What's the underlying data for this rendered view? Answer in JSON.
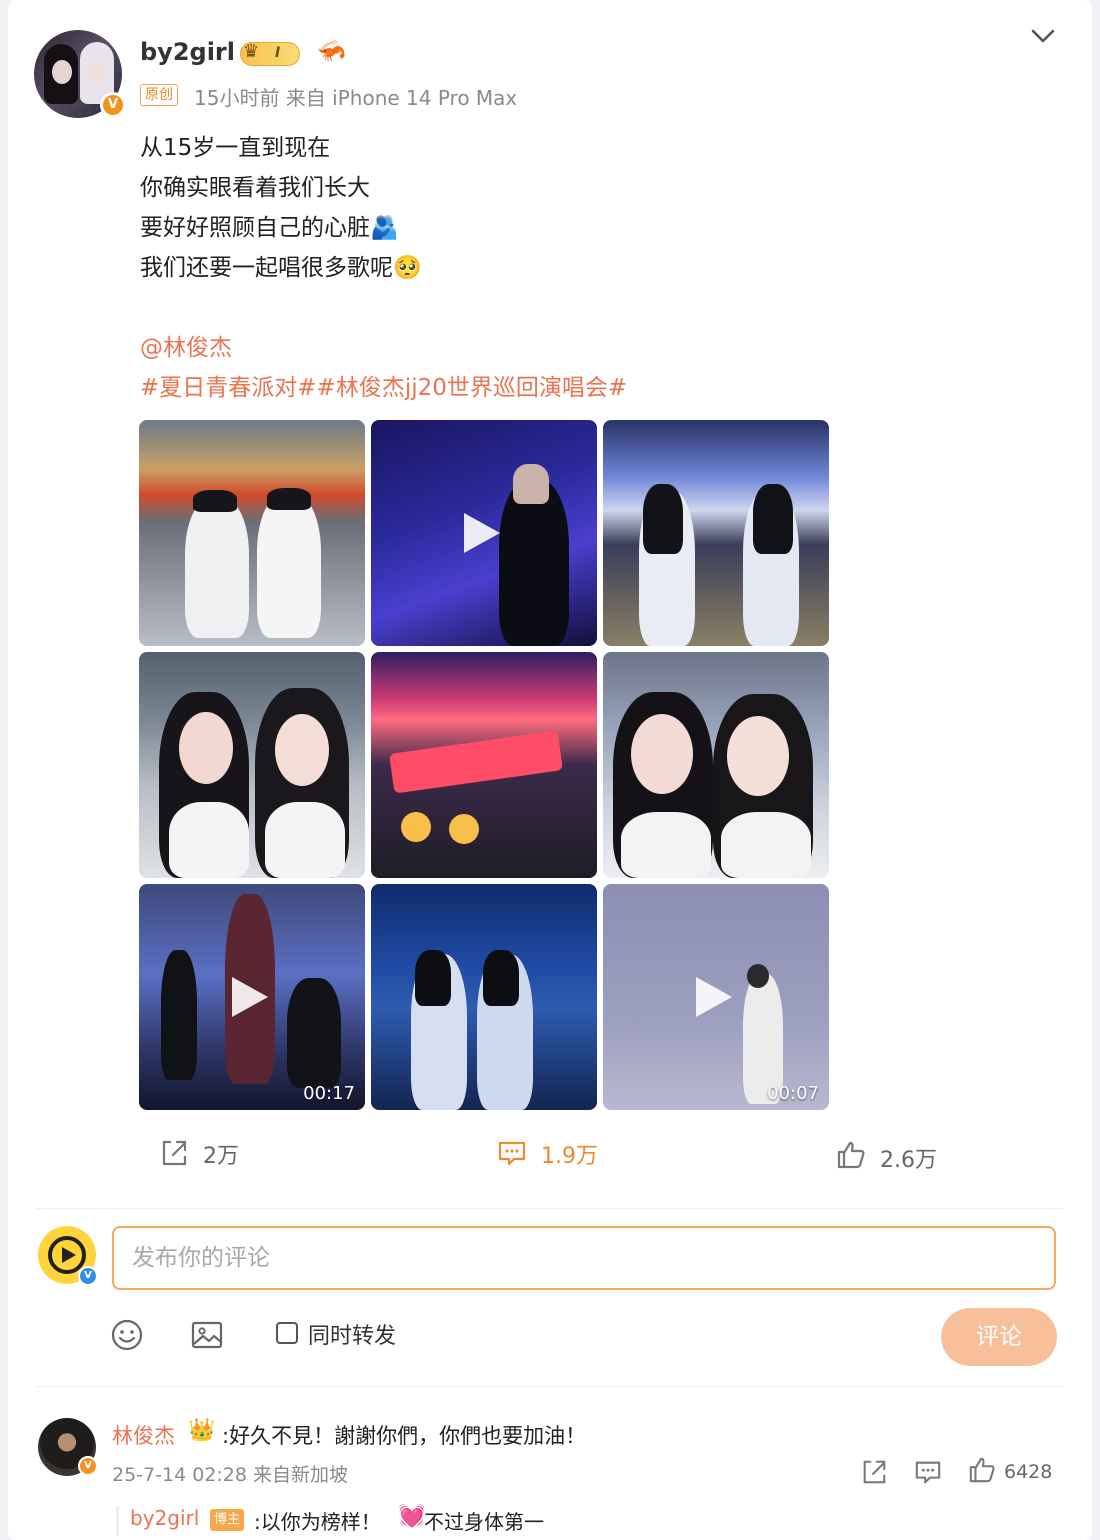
{
  "post": {
    "username": "by2girl",
    "level_badge": "I",
    "original_tag": "原创",
    "meta": "15小时前  来自 iPhone 14 Pro Max",
    "lines": [
      "从15岁一直到现在",
      "你确实眼看着我们长大",
      "要好好照顾自己的心脏🫂",
      "我们还要一起唱很多歌呢🥺"
    ],
    "mention": "@林俊杰",
    "hashtags": "#夏日青春派对##林俊杰jj20世界巡回演唱会#"
  },
  "media": [
    {
      "kind": "photo"
    },
    {
      "kind": "video",
      "duration": ""
    },
    {
      "kind": "photo"
    },
    {
      "kind": "photo"
    },
    {
      "kind": "photo"
    },
    {
      "kind": "photo"
    },
    {
      "kind": "video",
      "duration": "00:17"
    },
    {
      "kind": "photo"
    },
    {
      "kind": "video",
      "duration": "00:07"
    }
  ],
  "actions": {
    "repost_count": "2万",
    "comment_count": "1.9万",
    "like_count": "2.6万"
  },
  "composer": {
    "placeholder": "发布你的评论",
    "repost_checkbox_label": "同时转发",
    "submit_label": "评论"
  },
  "comment": {
    "author": "林俊杰",
    "text": ":好久不見！謝謝你們，你們也要加油！",
    "meta": "25-7-14 02:28  来自新加坡",
    "like_count": "6428",
    "reply": {
      "author": "by2girl",
      "author_tag": "博主",
      "text": ":以你为榜样！",
      "text2": "不过身体第一"
    }
  },
  "colors": {
    "accent": "#eb7350",
    "orange": "#f39221",
    "submit_bg": "#f8c09a"
  }
}
